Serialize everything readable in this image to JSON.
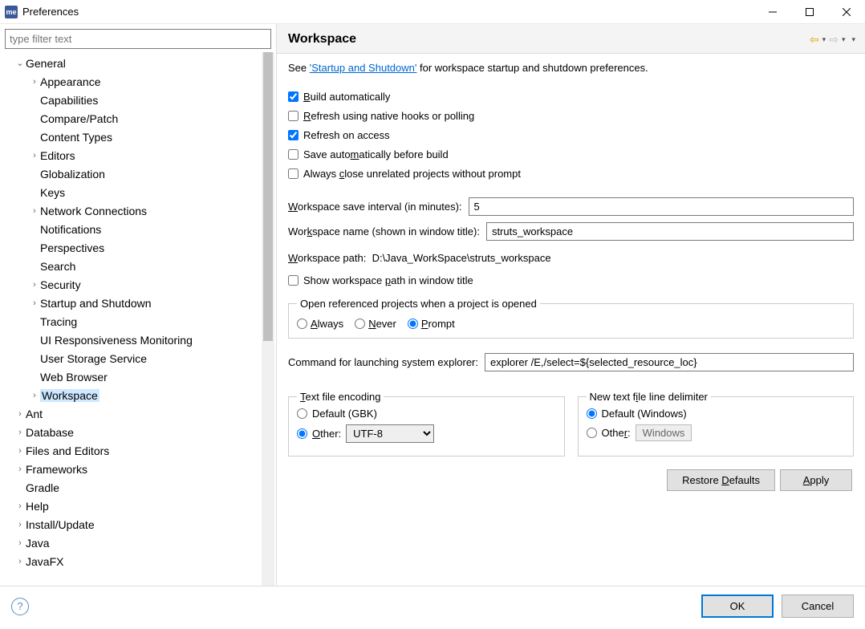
{
  "window": {
    "title": "Preferences",
    "appIconText": "me"
  },
  "sidebar": {
    "filterPlaceholder": "type filter text",
    "tree": [
      {
        "label": "General",
        "expanded": true,
        "level": 1,
        "hasChildren": true,
        "children": [
          {
            "label": "Appearance",
            "level": 2,
            "hasChildren": true
          },
          {
            "label": "Capabilities",
            "level": 2
          },
          {
            "label": "Compare/Patch",
            "level": 2
          },
          {
            "label": "Content Types",
            "level": 2
          },
          {
            "label": "Editors",
            "level": 2,
            "hasChildren": true
          },
          {
            "label": "Globalization",
            "level": 2
          },
          {
            "label": "Keys",
            "level": 2
          },
          {
            "label": "Network Connections",
            "level": 2,
            "hasChildren": true
          },
          {
            "label": "Notifications",
            "level": 2
          },
          {
            "label": "Perspectives",
            "level": 2
          },
          {
            "label": "Search",
            "level": 2
          },
          {
            "label": "Security",
            "level": 2,
            "hasChildren": true
          },
          {
            "label": "Startup and Shutdown",
            "level": 2,
            "hasChildren": true
          },
          {
            "label": "Tracing",
            "level": 2
          },
          {
            "label": "UI Responsiveness Monitoring",
            "level": 2
          },
          {
            "label": "User Storage Service",
            "level": 2
          },
          {
            "label": "Web Browser",
            "level": 2
          },
          {
            "label": "Workspace",
            "level": 2,
            "hasChildren": true,
            "selected": true
          }
        ]
      },
      {
        "label": "Ant",
        "level": 1,
        "hasChildren": true
      },
      {
        "label": "Database",
        "level": 1,
        "hasChildren": true
      },
      {
        "label": "Files and Editors",
        "level": 1,
        "hasChildren": true
      },
      {
        "label": "Frameworks",
        "level": 1,
        "hasChildren": true
      },
      {
        "label": "Gradle",
        "level": 1
      },
      {
        "label": "Help",
        "level": 1,
        "hasChildren": true
      },
      {
        "label": "Install/Update",
        "level": 1,
        "hasChildren": true
      },
      {
        "label": "Java",
        "level": 1,
        "hasChildren": true
      },
      {
        "label": "JavaFX",
        "level": 1,
        "hasChildren": true
      }
    ]
  },
  "page": {
    "title": "Workspace",
    "intro": {
      "prefix": "See ",
      "link": "'Startup and Shutdown'",
      "suffix": " for workspace startup and shutdown preferences."
    },
    "checks": [
      {
        "id": "buildAuto",
        "label": "Build automatically",
        "checked": true
      },
      {
        "id": "refreshNative",
        "label": "Refresh using native hooks or polling",
        "checked": false
      },
      {
        "id": "refreshAccess",
        "label": "Refresh on access",
        "checked": true
      },
      {
        "id": "saveBefore",
        "label": "Save automatically before build",
        "checked": false
      },
      {
        "id": "closeUnrel",
        "label": "Always close unrelated projects without prompt",
        "checked": false
      }
    ],
    "saveInterval": {
      "label": "Workspace save interval (in minutes):",
      "value": "5"
    },
    "wsName": {
      "label": "Workspace name (shown in window title):",
      "value": "struts_workspace"
    },
    "wsPath": {
      "label": "Workspace path:",
      "value": "D:\\Java_WorkSpace\\struts_workspace"
    },
    "showPath": {
      "label": "Show workspace path in window title",
      "checked": false
    },
    "openRef": {
      "legend": "Open referenced projects when a project is opened",
      "options": [
        {
          "label": "Always",
          "value": "always"
        },
        {
          "label": "Never",
          "value": "never"
        },
        {
          "label": "Prompt",
          "value": "prompt",
          "checked": true
        }
      ]
    },
    "explorer": {
      "label": "Command for launching system explorer:",
      "value": "explorer /E,/select=${selected_resource_loc}"
    },
    "encoding": {
      "legend": "Text file encoding",
      "defaultLabel": "Default (GBK)",
      "otherLabel": "Other:",
      "otherValue": "UTF-8",
      "selected": "other"
    },
    "lineDelim": {
      "legend": "New text file line delimiter",
      "defaultLabel": "Default (Windows)",
      "otherLabel": "Other:",
      "otherValue": "Windows",
      "selected": "default"
    },
    "buttons": {
      "restore": "Restore Defaults",
      "apply": "Apply"
    }
  },
  "footer": {
    "ok": "OK",
    "cancel": "Cancel"
  }
}
